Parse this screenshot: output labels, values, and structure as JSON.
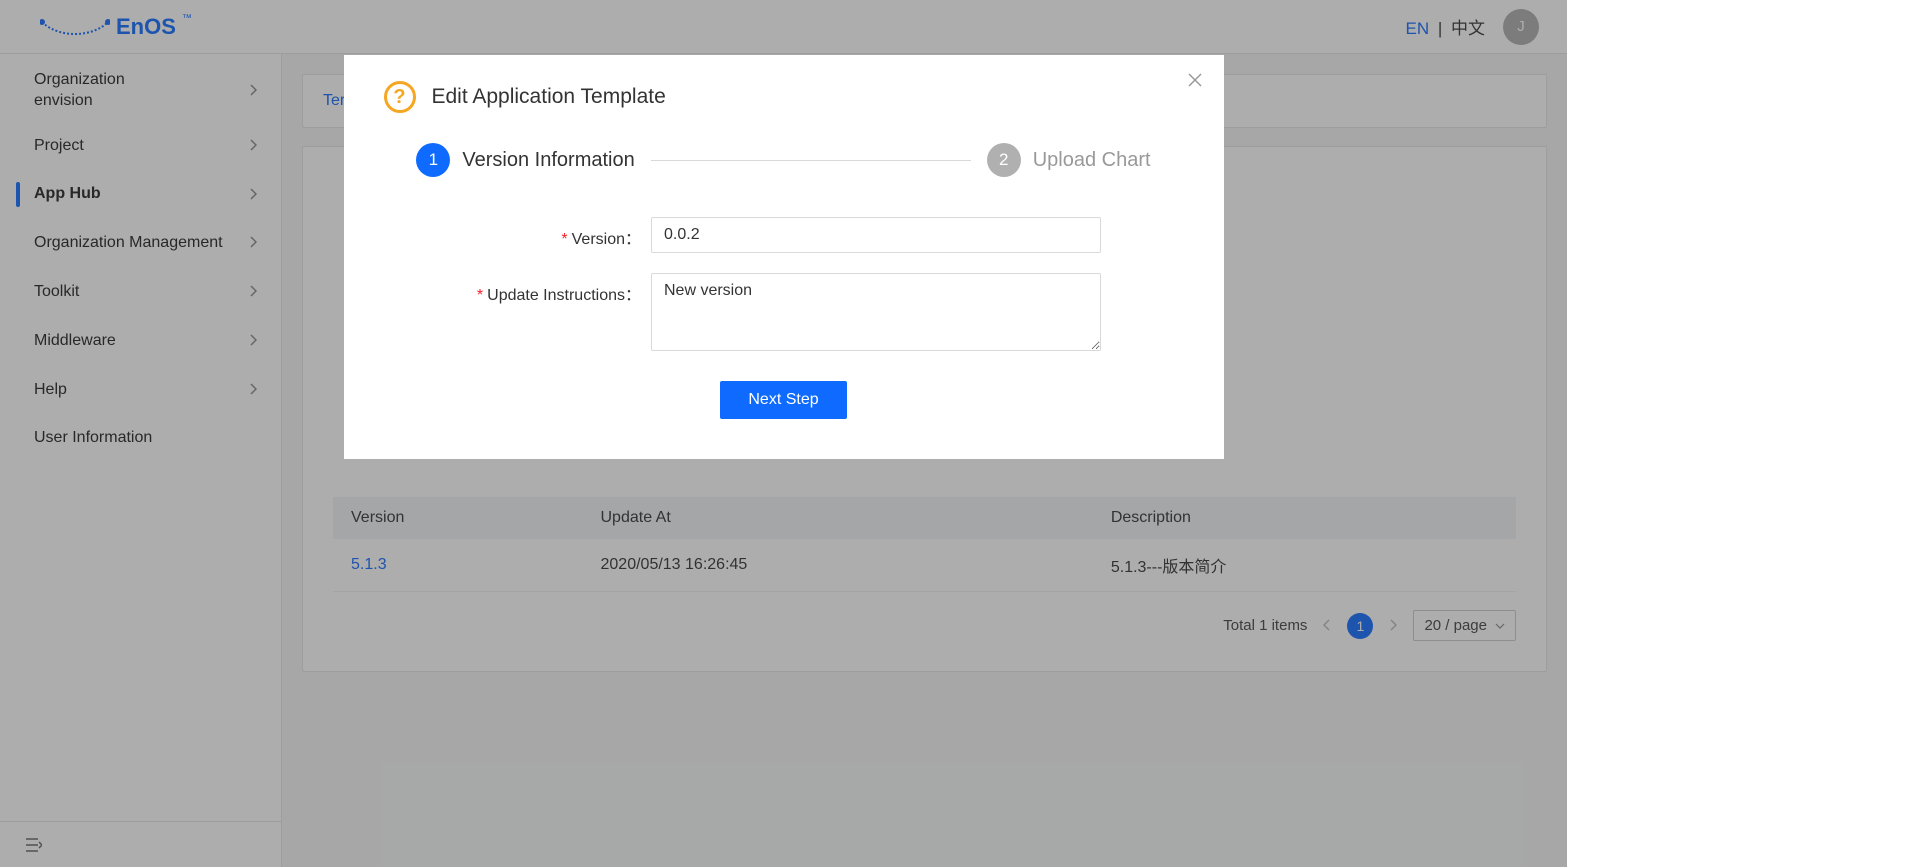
{
  "header": {
    "brand_text": "EnOS",
    "brand_tm": "™",
    "lang_en": "EN",
    "lang_sep": "|",
    "lang_zh": "中文",
    "avatar_initial": "J"
  },
  "sidebar": {
    "items": [
      {
        "label": "Organization envision",
        "has_children": true,
        "active": false
      },
      {
        "label": "Project",
        "has_children": true,
        "active": false
      },
      {
        "label": "App Hub",
        "has_children": true,
        "active": true
      },
      {
        "label": "Organization Management",
        "has_children": true,
        "active": false
      },
      {
        "label": "Toolkit",
        "has_children": true,
        "active": false
      },
      {
        "label": "Middleware",
        "has_children": true,
        "active": false
      },
      {
        "label": "Help",
        "has_children": true,
        "active": false
      },
      {
        "label": "User Information",
        "has_children": false,
        "active": false
      }
    ],
    "collapse_icon": "⇤"
  },
  "main": {
    "tab_label_partial": "Ter",
    "table": {
      "headers": {
        "version": "Version",
        "update_at": "Update At",
        "description": "Description"
      },
      "rows": [
        {
          "version": "5.1.3",
          "update_at": "2020/05/13 16:26:45",
          "description": "5.1.3---版本简介"
        }
      ]
    },
    "pager": {
      "total_text": "Total 1 items",
      "current_page": "1",
      "page_size_label": "20 / page"
    }
  },
  "modal": {
    "title": "Edit Application Template",
    "help_icon": "?",
    "steps": {
      "step1_num": "1",
      "step1_label": "Version Information",
      "step2_num": "2",
      "step2_label": "Upload Chart"
    },
    "form": {
      "version_label": "Version：",
      "version_value": "0.0.2",
      "instructions_label": "Update Instructions：",
      "instructions_value": "New version",
      "next_button": "Next Step"
    }
  }
}
